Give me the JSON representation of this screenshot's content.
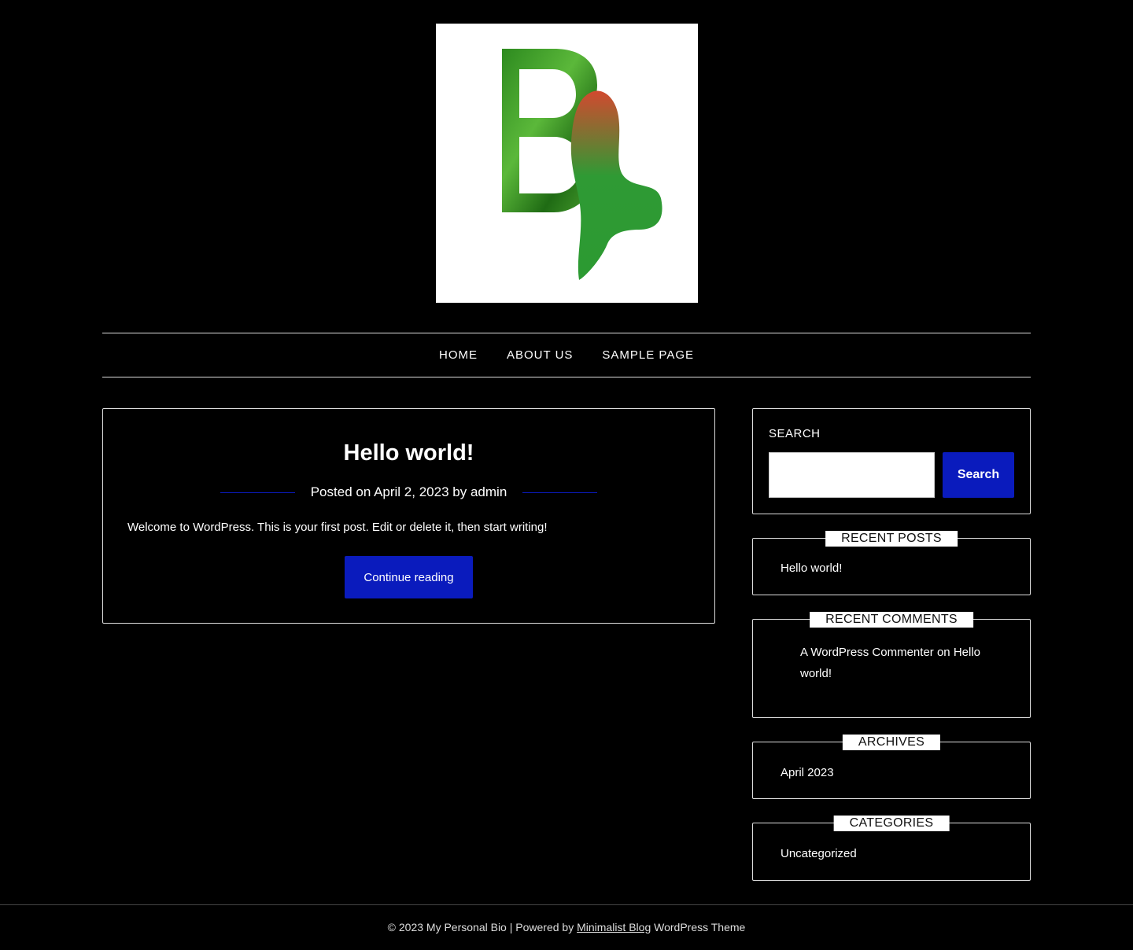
{
  "logo": {
    "icon": "blog-logo-icon"
  },
  "nav": {
    "items": [
      {
        "label": "HOME"
      },
      {
        "label": "ABOUT US"
      },
      {
        "label": "SAMPLE PAGE"
      }
    ]
  },
  "post": {
    "title": "Hello world!",
    "meta_prefix": "Posted on",
    "date": "April 2, 2023",
    "by": "by",
    "author": "admin",
    "excerpt": "Welcome to WordPress. This is your first post. Edit or delete it, then start writing!",
    "continue_label": "Continue reading"
  },
  "sidebar": {
    "search": {
      "title": "SEARCH",
      "input_value": "",
      "button_label": "Search"
    },
    "recent_posts": {
      "title": "RECENT POSTS",
      "items": [
        "Hello world!"
      ]
    },
    "recent_comments": {
      "title": "RECENT COMMENTS",
      "commenter": "A WordPress Commenter",
      "on": "on",
      "post_line1": "Hello",
      "post_line2": "world!"
    },
    "archives": {
      "title": "ARCHIVES",
      "items": [
        "April 2023"
      ]
    },
    "categories": {
      "title": "CATEGORIES",
      "items": [
        "Uncategorized"
      ]
    }
  },
  "footer": {
    "copyright": "© 2023 My Personal Bio | Powered by",
    "theme_link": "Minimalist Blog",
    "suffix": "WordPress Theme"
  },
  "colors": {
    "background": "#000000",
    "accent": "#0a1bbd",
    "text": "#ffffff"
  }
}
